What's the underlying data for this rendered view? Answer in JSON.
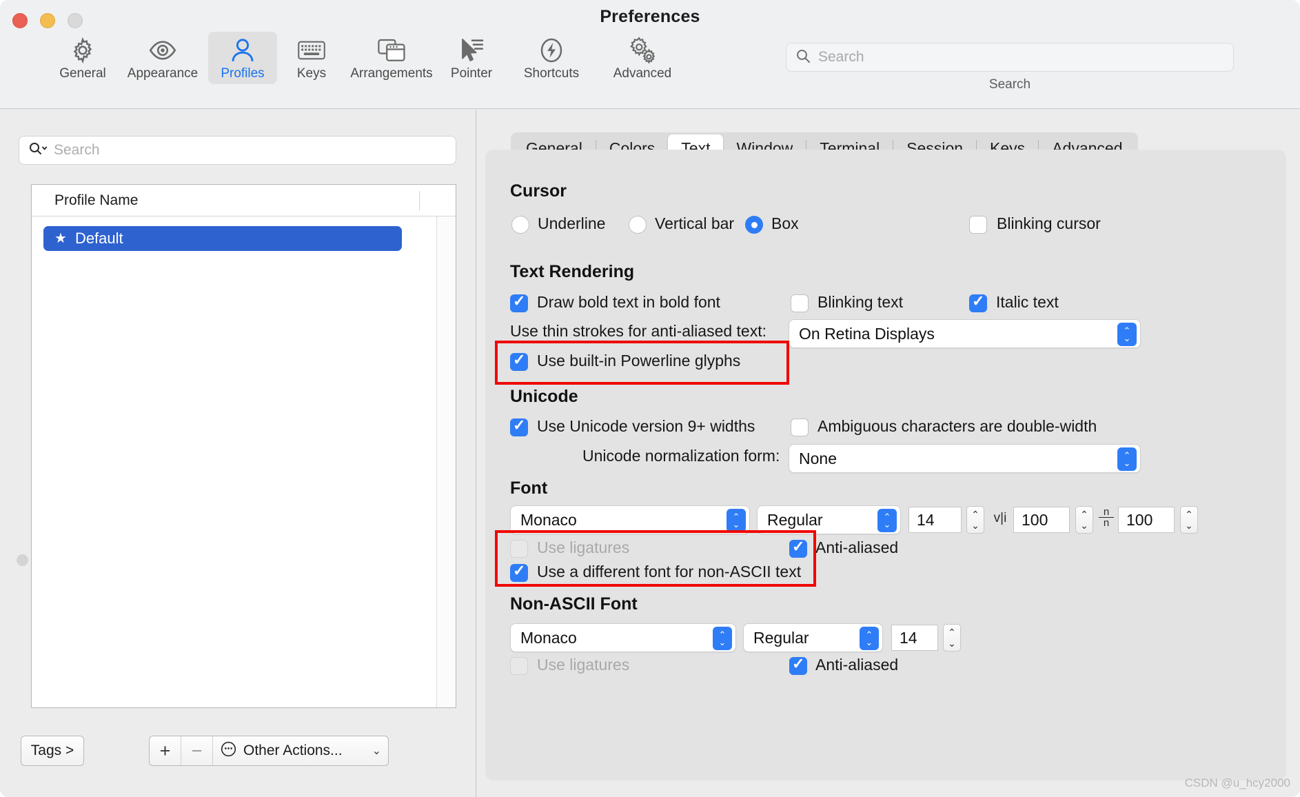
{
  "window": {
    "title": "Preferences",
    "traffic_lights": [
      "close-button",
      "minimize-button",
      "zoom-button"
    ]
  },
  "toolbar": {
    "items": [
      {
        "label": "General",
        "icon": "gear-icon",
        "selected": false
      },
      {
        "label": "Appearance",
        "icon": "eye-icon",
        "selected": false
      },
      {
        "label": "Profiles",
        "icon": "person-icon",
        "selected": true
      },
      {
        "label": "Keys",
        "icon": "keyboard-icon",
        "selected": false
      },
      {
        "label": "Arrangements",
        "icon": "windows-icon",
        "selected": false
      },
      {
        "label": "Pointer",
        "icon": "cursor-icon",
        "selected": false
      },
      {
        "label": "Shortcuts",
        "icon": "bolt-icon",
        "selected": false
      },
      {
        "label": "Advanced",
        "icon": "gears-icon",
        "selected": false
      }
    ],
    "search": {
      "placeholder": "Search",
      "value": "",
      "caption": "Search",
      "icon": "search-icon"
    }
  },
  "sidebar": {
    "search": {
      "placeholder": "Search",
      "value": "",
      "icon": "search-dropdown-icon"
    },
    "table": {
      "column_header": "Profile Name",
      "rows": [
        {
          "name": "Default",
          "starred": true,
          "selected": true
        }
      ]
    },
    "bottom": {
      "tags_label": "Tags >",
      "add_label": "+",
      "remove_label": "−",
      "other_actions_label": "Other Actions...",
      "other_actions_icon": "ellipsis-circle-icon",
      "chevron_icon": "chevron-down-icon"
    }
  },
  "panel": {
    "tabs": [
      {
        "label": "General",
        "active": false
      },
      {
        "label": "Colors",
        "active": false
      },
      {
        "label": "Text",
        "active": true
      },
      {
        "label": "Window",
        "active": false
      },
      {
        "label": "Terminal",
        "active": false
      },
      {
        "label": "Session",
        "active": false
      },
      {
        "label": "Keys",
        "active": false
      },
      {
        "label": "Advanced",
        "active": false
      }
    ],
    "cursor": {
      "title": "Cursor",
      "options": [
        {
          "label": "Underline",
          "selected": false
        },
        {
          "label": "Vertical bar",
          "selected": false
        },
        {
          "label": "Box",
          "selected": true
        }
      ],
      "blinking": {
        "label": "Blinking cursor",
        "checked": false
      }
    },
    "text_rendering": {
      "title": "Text Rendering",
      "bold": {
        "label": "Draw bold text in bold font",
        "checked": true
      },
      "blinking_text": {
        "label": "Blinking text",
        "checked": false
      },
      "italic_text": {
        "label": "Italic text",
        "checked": true
      },
      "thin_strokes_label": "Use thin strokes for anti-aliased text:",
      "thin_strokes_value": "On Retina Displays",
      "powerline": {
        "label": "Use built-in Powerline glyphs",
        "checked": true,
        "highlighted": true
      }
    },
    "unicode": {
      "title": "Unicode",
      "version9": {
        "label": "Use Unicode version 9+ widths",
        "checked": true
      },
      "ambiguous": {
        "label": "Ambiguous characters are double-width",
        "checked": false
      },
      "normalization_label": "Unicode normalization form:",
      "normalization_value": "None"
    },
    "font": {
      "title": "Font",
      "family": "Monaco",
      "style": "Regular",
      "size": "14",
      "horizontal_spacing": "100",
      "horizontal_spacing_icon": "horizontal-spacing-icon",
      "vertical_spacing": "100",
      "vertical_spacing_icon": "vertical-spacing-icon",
      "ligatures": {
        "label": "Use ligatures",
        "checked": false,
        "disabled": true
      },
      "antialiased": {
        "label": "Anti-aliased",
        "checked": true
      },
      "different_font_nonascii": {
        "label": "Use a different font for non-ASCII text",
        "checked": true,
        "highlighted": true
      }
    },
    "nonascii_font": {
      "title": "Non-ASCII Font",
      "family": "Monaco",
      "style": "Regular",
      "size": "14",
      "ligatures": {
        "label": "Use ligatures",
        "checked": false,
        "disabled": true
      },
      "antialiased": {
        "label": "Anti-aliased",
        "checked": true
      }
    }
  },
  "watermark": "CSDN @u_hcy2000",
  "colors": {
    "accent_blue": "#2f7df6",
    "selection_blue": "#2d62cf",
    "annotation_red": "#f00705",
    "panel_bg": "#e3e3e3",
    "window_bg": "#ececec"
  }
}
